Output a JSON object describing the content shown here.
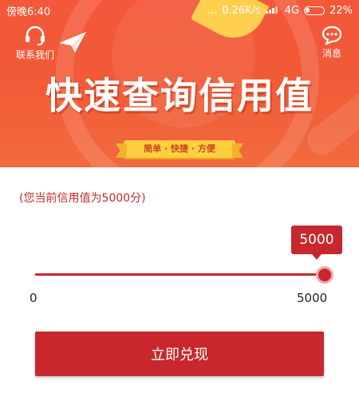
{
  "status_bar": {
    "time": "傍晚6:40",
    "network_speed": "0.26K/s",
    "network_type": "4G",
    "battery": "22%",
    "dots": "..."
  },
  "header": {
    "contact_label": "联系我们",
    "contact_icon": "headset-icon",
    "message_label": "消息",
    "message_icon": "chat-bubble-icon",
    "decor_icon": "paper-plane-icon"
  },
  "banner": {
    "title": "快速查询信用值",
    "tagline": "简单 · 快捷 · 方便"
  },
  "credit": {
    "note": "(您当前信用值为5000分)",
    "value_label": "5000",
    "value": 5000,
    "min": 0,
    "max": 5000,
    "min_label": "0",
    "max_label": "5000"
  },
  "action": {
    "redeem_label": "立即兑现"
  },
  "colors": {
    "banner": "#f15a36",
    "accent": "#c8282d",
    "ribbon": "#ffcf3f"
  }
}
